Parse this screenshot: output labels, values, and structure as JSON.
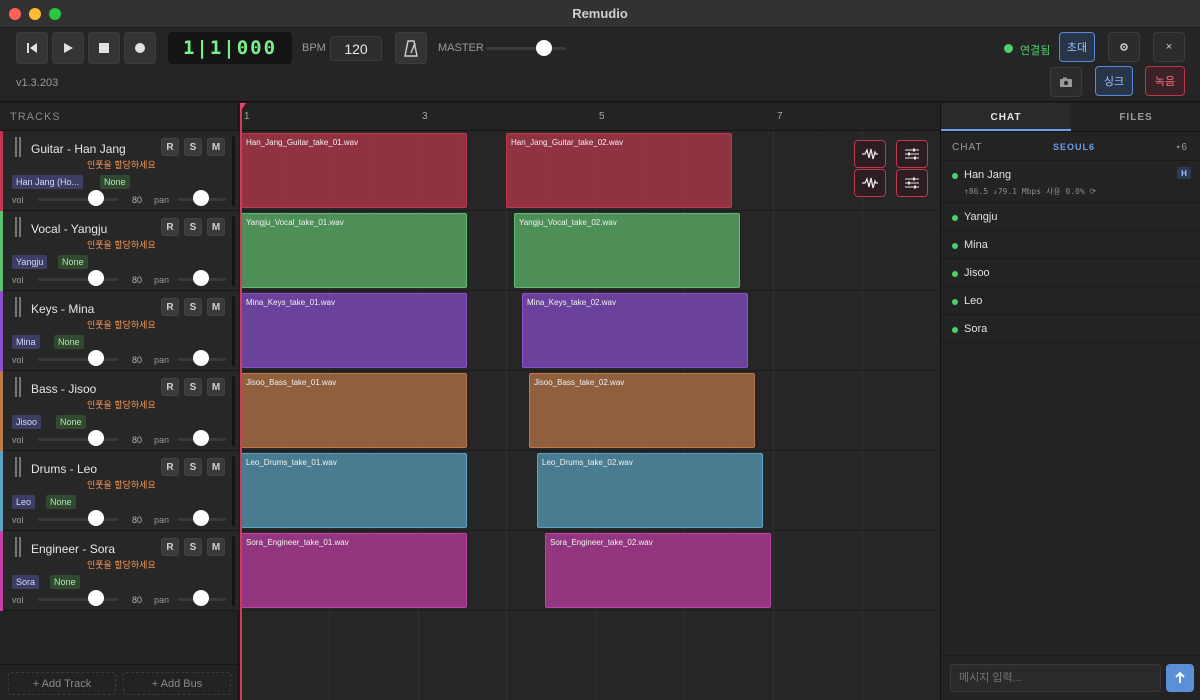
{
  "app": {
    "title": "Remudio",
    "version": "v1.3.203"
  },
  "transport": {
    "position": "1|1|000",
    "bpm_label": "BPM",
    "bpm": "120",
    "master_label": "MASTER",
    "master_level": 0.72,
    "connection": "연결됨",
    "invite_label": "초대",
    "settings_icon": "gear-icon",
    "close_label": "×",
    "sync_label": "싱크",
    "record_label": "녹음"
  },
  "tracks_panel": {
    "header": "TRACKS",
    "add_track": "+ Add Track",
    "add_bus": "+ Add Bus"
  },
  "tracks": [
    {
      "name": "Guitar - Han Jang",
      "hint": "인풋을 할당하세요",
      "owner": "Han Jang (Ho...",
      "input": "None",
      "vol_label": "vol",
      "vol": "80",
      "pan_label": "pan",
      "color": "#c0384f",
      "r": "R",
      "s": "S",
      "m": "M"
    },
    {
      "name": "Vocal - Yangju",
      "hint": "인풋을 할당하세요",
      "owner": "Yangju",
      "input": "None",
      "vol_label": "vol",
      "vol": "80",
      "pan_label": "pan",
      "color": "#5fbf6e",
      "r": "R",
      "s": "S",
      "m": "M"
    },
    {
      "name": "Keys - Mina",
      "hint": "인풋을 할당하세요",
      "owner": "Mina",
      "input": "None",
      "vol_label": "vol",
      "vol": "80",
      "pan_label": "pan",
      "color": "#8a4fd0",
      "r": "R",
      "s": "S",
      "m": "M"
    },
    {
      "name": "Bass - Jisoo",
      "hint": "인풋을 할당하세요",
      "owner": "Jisoo",
      "input": "None",
      "vol_label": "vol",
      "vol": "80",
      "pan_label": "pan",
      "color": "#c07a4a",
      "r": "R",
      "s": "S",
      "m": "M"
    },
    {
      "name": "Drums - Leo",
      "hint": "인풋을 할당하세요",
      "owner": "Leo",
      "input": "None",
      "vol_label": "vol",
      "vol": "80",
      "pan_label": "pan",
      "color": "#5aa3c2",
      "r": "R",
      "s": "S",
      "m": "M"
    },
    {
      "name": "Engineer - Sora",
      "hint": "인풋을 할당하세요",
      "owner": "Sora",
      "input": "None",
      "vol_label": "vol",
      "vol": "80",
      "pan_label": "pan",
      "color": "#c440a8",
      "r": "R",
      "s": "S",
      "m": "M"
    }
  ],
  "ruler": {
    "marks": [
      "1",
      "3",
      "5",
      "7"
    ]
  },
  "clips": [
    [
      "Han_Jang_Guitar_take_01.wav",
      "Han_Jang_Guitar_take_02.wav"
    ],
    [
      "Yangju_Vocal_take_01.wav",
      "Yangju_Vocal_take_02.wav"
    ],
    [
      "Mina_Keys_take_01.wav",
      "Mina_Keys_take_02.wav"
    ],
    [
      "Jisoo_Bass_take_01.wav",
      "Jisoo_Bass_take_02.wav"
    ],
    [
      "Leo_Drums_take_01.wav",
      "Leo_Drums_take_02.wav"
    ],
    [
      "Sora_Engineer_take_01.wav",
      "Sora_Engineer_take_02.wav"
    ]
  ],
  "right_panel": {
    "tab_chat": "CHAT",
    "tab_files": "FILES",
    "chat_label": "CHAT",
    "room": "SEOUL6",
    "user_count": "⋆6",
    "host_badge": "H",
    "host_stats": "↑86.5 ↓79.1 Mbps  사용 0.0%  ⟳",
    "users": [
      "Han Jang",
      "Yangju",
      "Mina",
      "Jisoo",
      "Leo",
      "Sora"
    ],
    "input_placeholder": "메시지 입력..."
  },
  "colors": {
    "accent": "#6b9fe6",
    "record": "#c2364f",
    "online": "#4fd06a",
    "counter": "#7cf08a"
  }
}
